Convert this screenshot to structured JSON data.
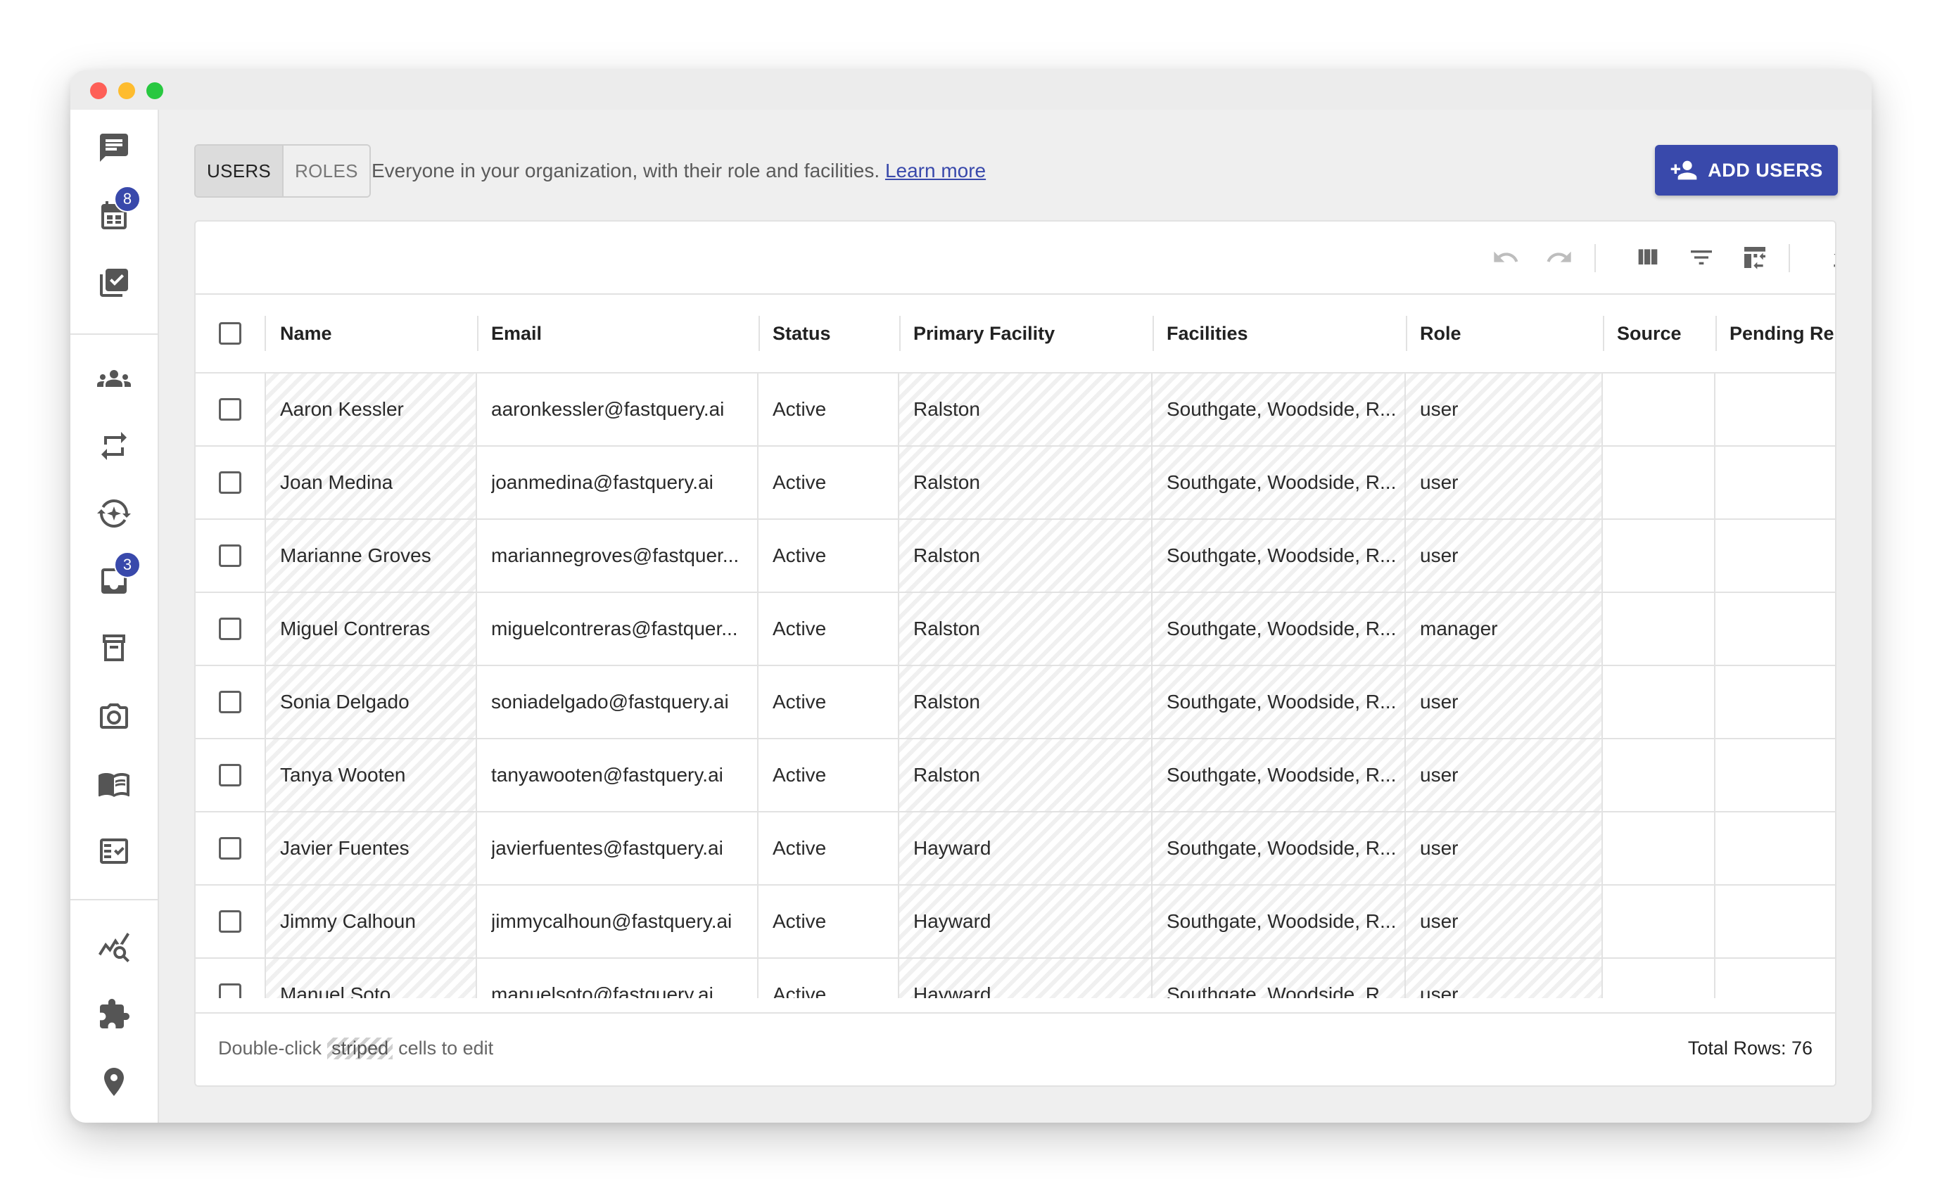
{
  "tabs": [
    {
      "label": "USERS",
      "active": true
    },
    {
      "label": "ROLES",
      "active": false
    }
  ],
  "description": {
    "text": "Everyone in your organization, with their role and facilities.",
    "link": "Learn more"
  },
  "add_button": {
    "label": "ADD USERS",
    "icon": "person-add-icon"
  },
  "sidebar": {
    "badges": {
      "calendar": "8",
      "inbox": "3"
    }
  },
  "table": {
    "columns": [
      "Name",
      "Email",
      "Status",
      "Primary Facility",
      "Facilities",
      "Role",
      "Source",
      "Pending Rer"
    ],
    "rows": [
      {
        "name": "Aaron Kessler",
        "email": "aaronkessler@fastquery.ai",
        "status": "Active",
        "primary": "Ralston",
        "facilities": "Southgate, Woodside, R...",
        "role": "user"
      },
      {
        "name": "Joan Medina",
        "email": "joanmedina@fastquery.ai",
        "status": "Active",
        "primary": "Ralston",
        "facilities": "Southgate, Woodside, R...",
        "role": "user"
      },
      {
        "name": "Marianne Groves",
        "email": "mariannegroves@fastquer...",
        "status": "Active",
        "primary": "Ralston",
        "facilities": "Southgate, Woodside, R...",
        "role": "user"
      },
      {
        "name": "Miguel Contreras",
        "email": "miguelcontreras@fastquer...",
        "status": "Active",
        "primary": "Ralston",
        "facilities": "Southgate, Woodside, R...",
        "role": "manager"
      },
      {
        "name": "Sonia Delgado",
        "email": "soniadelgado@fastquery.ai",
        "status": "Active",
        "primary": "Ralston",
        "facilities": "Southgate, Woodside, R...",
        "role": "user"
      },
      {
        "name": "Tanya Wooten",
        "email": "tanyawooten@fastquery.ai",
        "status": "Active",
        "primary": "Ralston",
        "facilities": "Southgate, Woodside, R...",
        "role": "user"
      },
      {
        "name": "Javier Fuentes",
        "email": "javierfuentes@fastquery.ai",
        "status": "Active",
        "primary": "Hayward",
        "facilities": "Southgate, Woodside, R...",
        "role": "user"
      },
      {
        "name": "Jimmy Calhoun",
        "email": "jimmycalhoun@fastquery.ai",
        "status": "Active",
        "primary": "Hayward",
        "facilities": "Southgate, Woodside, R...",
        "role": "user"
      },
      {
        "name": "Manuel Soto",
        "email": "manuelsoto@fastquery.ai",
        "status": "Active",
        "primary": "Hayward",
        "facilities": "Southgate, Woodside, R...",
        "role": "user"
      }
    ]
  },
  "footer": {
    "hint_prefix": "Double-click",
    "hint_striped": "striped",
    "hint_suffix": "cells to edit",
    "total": "Total Rows: 76"
  }
}
